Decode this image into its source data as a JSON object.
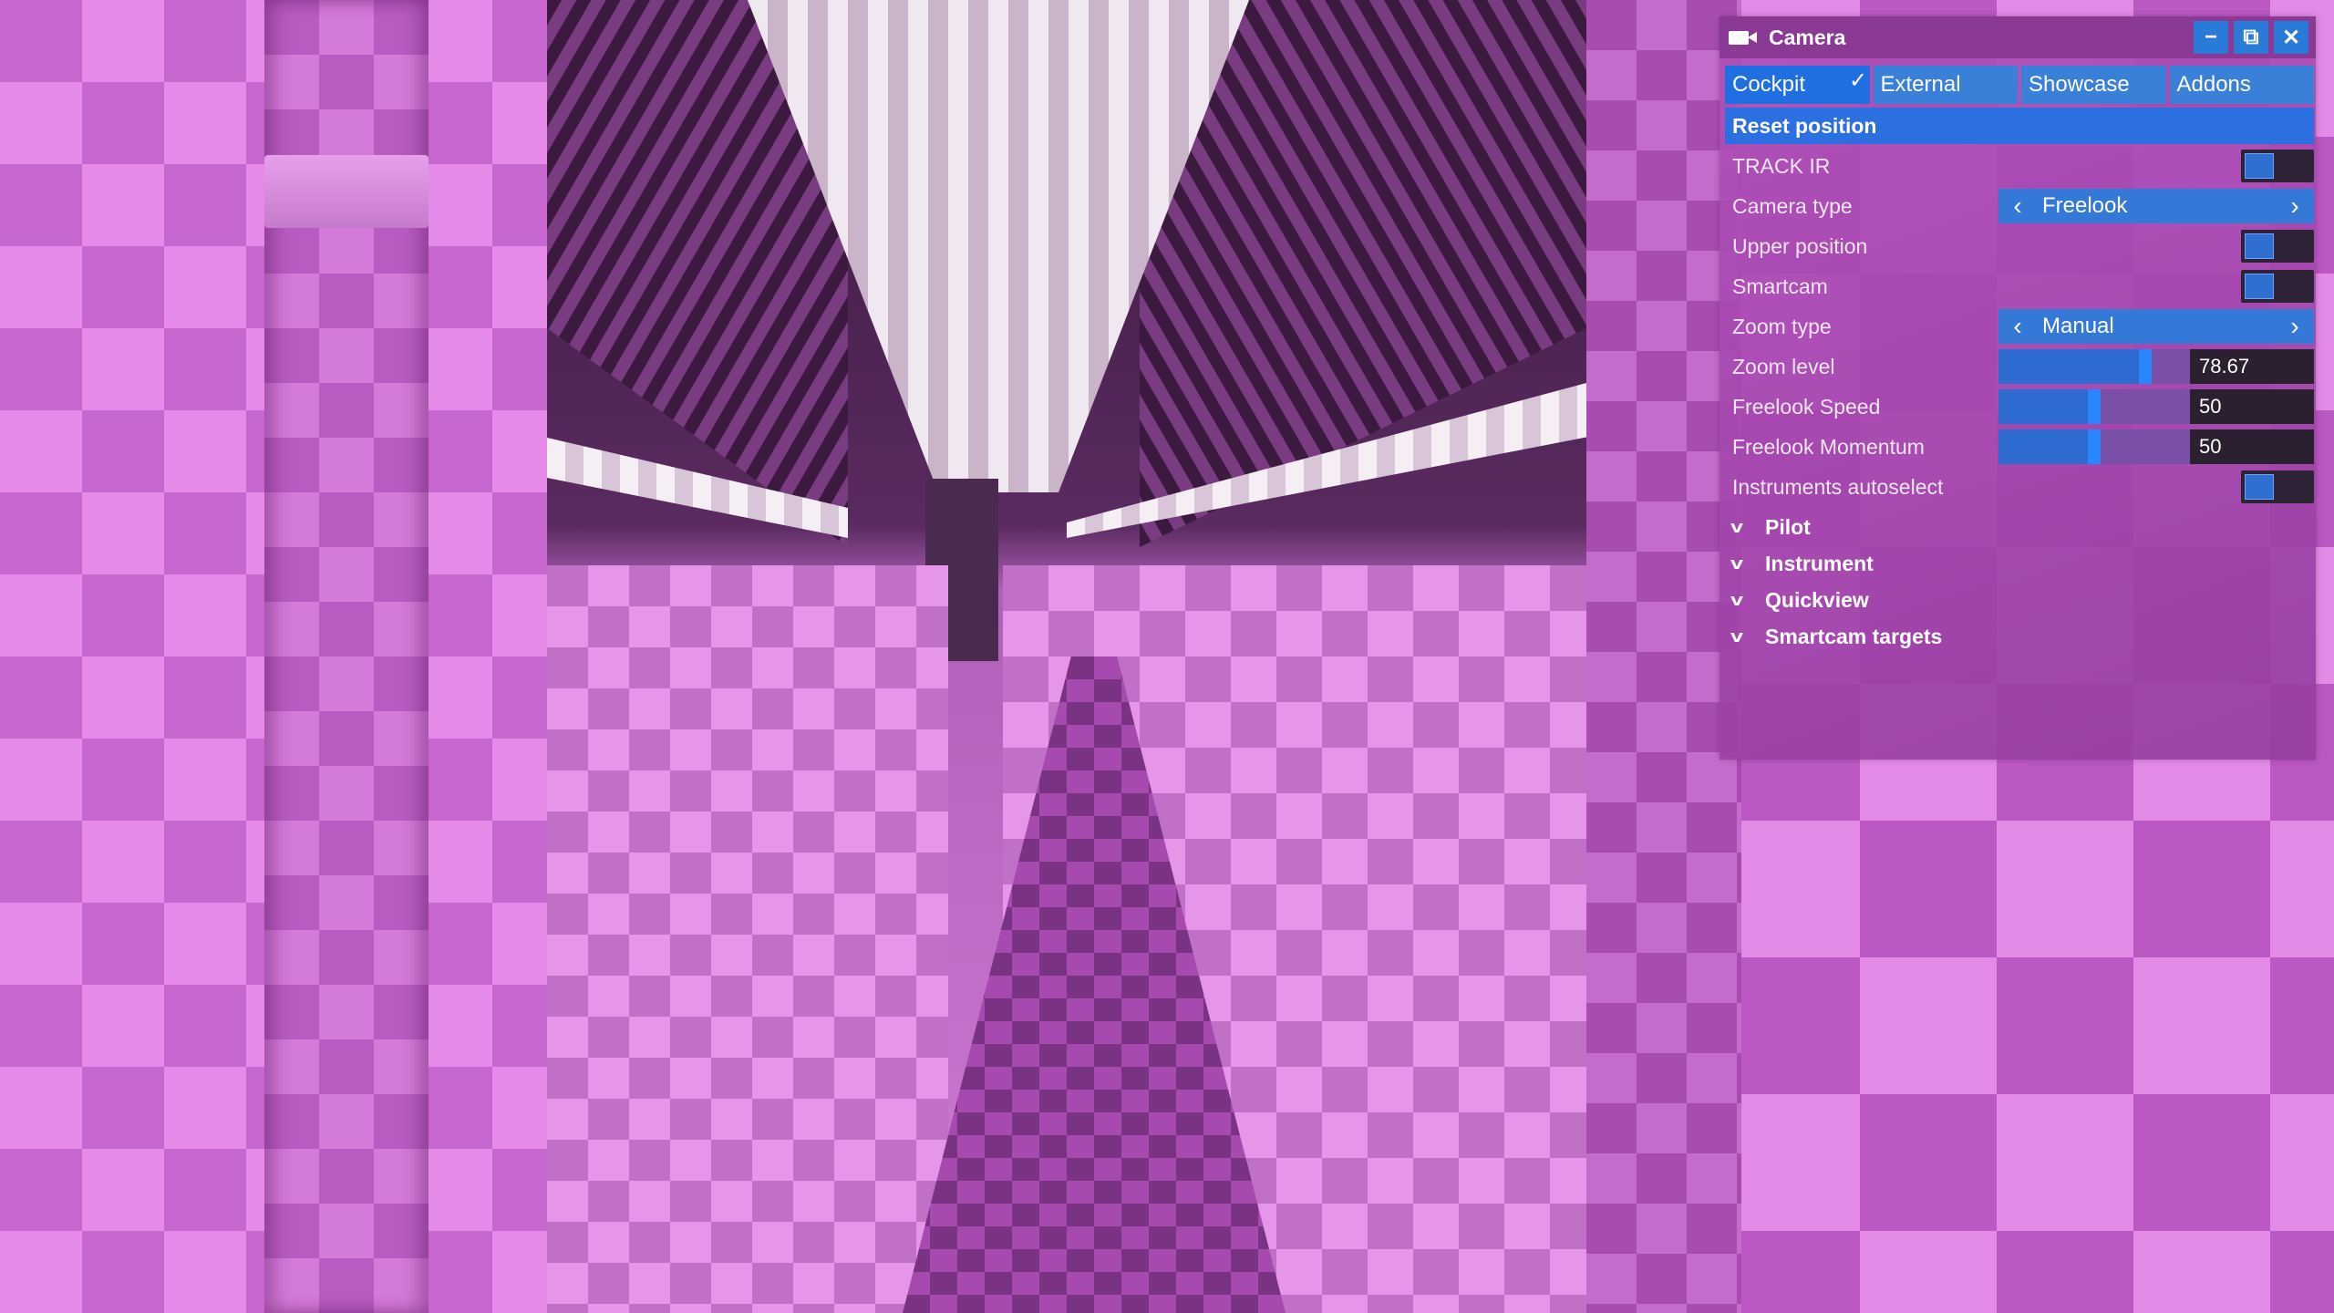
{
  "panel": {
    "title": "Camera",
    "window_buttons": {
      "minimize": "−",
      "popout": "⧉",
      "close": "✕"
    },
    "tabs": [
      {
        "label": "Cockpit",
        "active": true
      },
      {
        "label": "External",
        "active": false
      },
      {
        "label": "Showcase",
        "active": false
      },
      {
        "label": "Addons",
        "active": false
      }
    ],
    "reset_label": "Reset position",
    "rows": {
      "track_ir": {
        "label": "TRACK IR",
        "value": false
      },
      "camera_type": {
        "label": "Camera type",
        "value": "Freelook"
      },
      "upper_position": {
        "label": "Upper position",
        "value": false
      },
      "smartcam": {
        "label": "Smartcam",
        "value": false
      },
      "zoom_type": {
        "label": "Zoom type",
        "value": "Manual"
      },
      "zoom_level": {
        "label": "Zoom level",
        "value": "78.67",
        "fraction": 0.7867
      },
      "freelook_speed": {
        "label": "Freelook Speed",
        "value": "50",
        "fraction": 0.5
      },
      "freelook_momentum": {
        "label": "Freelook Momentum",
        "value": "50",
        "fraction": 0.5
      },
      "instruments_autoselect": {
        "label": "Instruments autoselect",
        "value": false
      }
    },
    "sections": [
      "Pilot",
      "Instrument",
      "Quickview",
      "Smartcam targets"
    ]
  },
  "colors": {
    "accent": "#2b6fe0",
    "panel_bg": "#b050ba",
    "titlebar": "#8a3a94"
  }
}
